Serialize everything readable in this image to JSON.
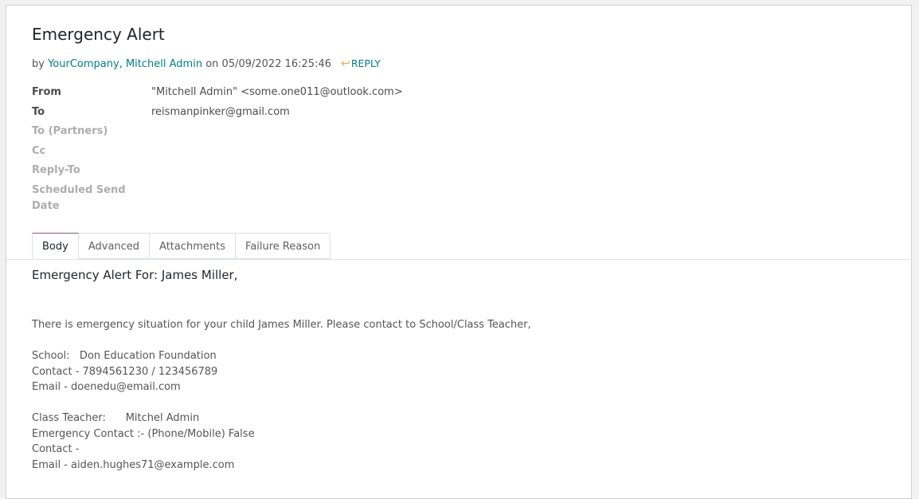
{
  "message": {
    "title": "Emergency Alert",
    "byline": {
      "by": "by",
      "authors": "YourCompany, Mitchell Admin",
      "on": "on",
      "date": "05/09/2022 16:25:46",
      "reply_label": "REPLY"
    }
  },
  "fields": [
    {
      "label": "From",
      "value": "\"Mitchell Admin\" <some.one011@outlook.com>"
    },
    {
      "label": "To",
      "value": "reismanpinker@gmail.com"
    },
    {
      "label": "To (Partners)",
      "value": ""
    },
    {
      "label": "Cc",
      "value": ""
    },
    {
      "label": "Reply-To",
      "value": ""
    },
    {
      "label": "Scheduled Send",
      "label2": "Date",
      "value": ""
    }
  ],
  "tabs": [
    {
      "label": "Body",
      "active": true
    },
    {
      "label": "Advanced",
      "active": false
    },
    {
      "label": "Attachments",
      "active": false
    },
    {
      "label": "Failure Reason",
      "active": false
    }
  ],
  "body": {
    "heading": "Emergency Alert For: James Miller,",
    "intro": "There is emergency situation for your child James Miller. Please contact to School/Class Teacher,",
    "school_line": "School:   Don Education Foundation",
    "contact_line": "Contact - 7894561230 / 123456789",
    "school_email": "Email - doenedu@email.com",
    "teacher_line": "Class Teacher:      Mitchel Admin",
    "emergency_line": "Emergency Contact :- (Phone/Mobile) False",
    "teacher_contact": "Contact -",
    "teacher_email": "Email - aiden.hughes71@example.com"
  },
  "colors": {
    "link": "#017e84",
    "reply_icon": "#f0ad4e",
    "active_tab_accent": "#875a7b"
  },
  "icons": {
    "reply": "reply-arrow-icon"
  }
}
